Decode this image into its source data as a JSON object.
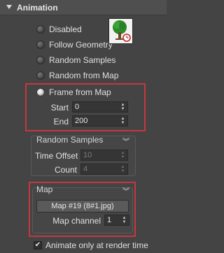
{
  "rollout": {
    "title": "Animation",
    "collapse_icon": "triangle-down-icon"
  },
  "radios": {
    "disabled": "Disabled",
    "follow_geometry": "Follow Geometry",
    "random_samples": "Random Samples",
    "random_from_map": "Random from Map",
    "frame_from_map": "Frame from Map",
    "selected": "frame_from_map"
  },
  "thumbnail": {
    "icon": "tree-clock-icon"
  },
  "frame_from_map": {
    "start_label": "Start",
    "start_value": "0",
    "end_label": "End",
    "end_value": "200"
  },
  "random_samples_group": {
    "title": "Random Samples",
    "time_offset_label": "Time Offset",
    "time_offset_value": "10",
    "count_label": "Count",
    "count_value": "4"
  },
  "map_group": {
    "title": "Map",
    "map_button": "Map #19 (8#1.jpg)",
    "channel_label": "Map channel",
    "channel_value": "1"
  },
  "animate_checkbox": {
    "label": "Animate only at render time",
    "checked": true
  },
  "colors": {
    "accent_red": "#c4383f",
    "panel_bg": "#444444"
  }
}
